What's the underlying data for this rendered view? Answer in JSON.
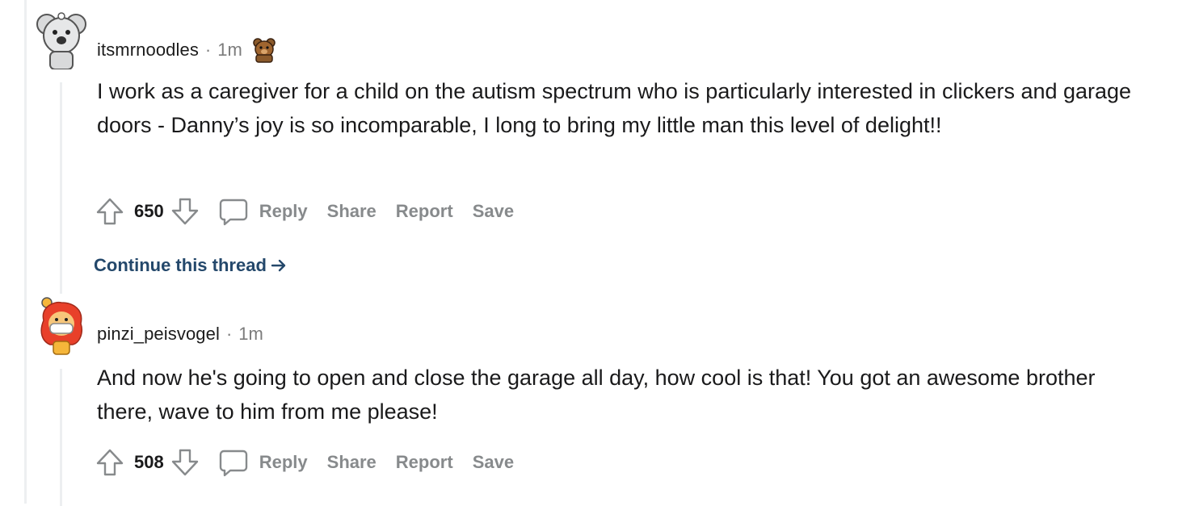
{
  "comments": [
    {
      "username": "itsmrnoodles",
      "separator": "·",
      "time": "1m",
      "badge_icon": "bear-award-icon",
      "avatar_icon": "koala-avatar-icon",
      "body": "I work as a caregiver for a child on the autism spectrum who is particularly interested in clickers and garage doors - Danny’s joy is so incomparable, I long to bring my little man this level of delight!!",
      "score": "650",
      "actions": {
        "reply": "Reply",
        "share": "Share",
        "report": "Report",
        "save": "Save"
      },
      "continue_thread": "Continue this thread"
    },
    {
      "username": "pinzi_peisvogel",
      "separator": "·",
      "time": "1m",
      "avatar_icon": "red-hair-mask-avatar-icon",
      "body": "And now he's going to open and close the garage all day, how cool is that! You got an awesome brother there, wave to him from me please!",
      "score": "508",
      "actions": {
        "reply": "Reply",
        "share": "Share",
        "report": "Report",
        "save": "Save"
      }
    }
  ],
  "colors": {
    "text": "#1a1a1b",
    "muted": "#878a8c",
    "link": "#24486b",
    "rail": "#edeff1"
  }
}
